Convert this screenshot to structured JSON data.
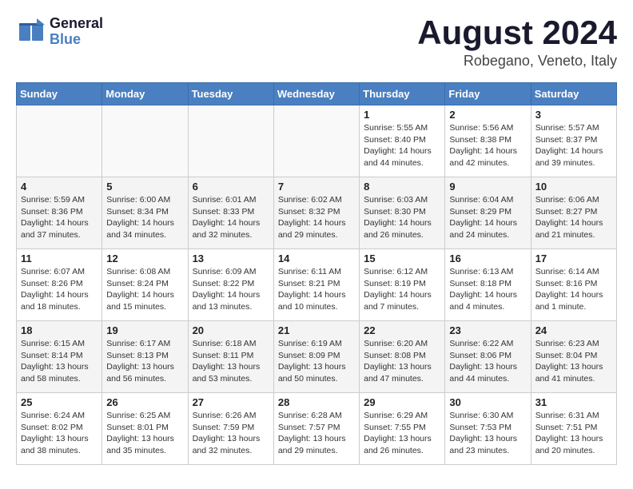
{
  "header": {
    "logo_line1": "General",
    "logo_line2": "Blue",
    "month_year": "August 2024",
    "location": "Robegano, Veneto, Italy"
  },
  "days_of_week": [
    "Sunday",
    "Monday",
    "Tuesday",
    "Wednesday",
    "Thursday",
    "Friday",
    "Saturday"
  ],
  "weeks": [
    [
      {
        "day": "",
        "content": ""
      },
      {
        "day": "",
        "content": ""
      },
      {
        "day": "",
        "content": ""
      },
      {
        "day": "",
        "content": ""
      },
      {
        "day": "1",
        "content": "Sunrise: 5:55 AM\nSunset: 8:40 PM\nDaylight: 14 hours\nand 44 minutes."
      },
      {
        "day": "2",
        "content": "Sunrise: 5:56 AM\nSunset: 8:38 PM\nDaylight: 14 hours\nand 42 minutes."
      },
      {
        "day": "3",
        "content": "Sunrise: 5:57 AM\nSunset: 8:37 PM\nDaylight: 14 hours\nand 39 minutes."
      }
    ],
    [
      {
        "day": "4",
        "content": "Sunrise: 5:59 AM\nSunset: 8:36 PM\nDaylight: 14 hours\nand 37 minutes."
      },
      {
        "day": "5",
        "content": "Sunrise: 6:00 AM\nSunset: 8:34 PM\nDaylight: 14 hours\nand 34 minutes."
      },
      {
        "day": "6",
        "content": "Sunrise: 6:01 AM\nSunset: 8:33 PM\nDaylight: 14 hours\nand 32 minutes."
      },
      {
        "day": "7",
        "content": "Sunrise: 6:02 AM\nSunset: 8:32 PM\nDaylight: 14 hours\nand 29 minutes."
      },
      {
        "day": "8",
        "content": "Sunrise: 6:03 AM\nSunset: 8:30 PM\nDaylight: 14 hours\nand 26 minutes."
      },
      {
        "day": "9",
        "content": "Sunrise: 6:04 AM\nSunset: 8:29 PM\nDaylight: 14 hours\nand 24 minutes."
      },
      {
        "day": "10",
        "content": "Sunrise: 6:06 AM\nSunset: 8:27 PM\nDaylight: 14 hours\nand 21 minutes."
      }
    ],
    [
      {
        "day": "11",
        "content": "Sunrise: 6:07 AM\nSunset: 8:26 PM\nDaylight: 14 hours\nand 18 minutes."
      },
      {
        "day": "12",
        "content": "Sunrise: 6:08 AM\nSunset: 8:24 PM\nDaylight: 14 hours\nand 15 minutes."
      },
      {
        "day": "13",
        "content": "Sunrise: 6:09 AM\nSunset: 8:22 PM\nDaylight: 14 hours\nand 13 minutes."
      },
      {
        "day": "14",
        "content": "Sunrise: 6:11 AM\nSunset: 8:21 PM\nDaylight: 14 hours\nand 10 minutes."
      },
      {
        "day": "15",
        "content": "Sunrise: 6:12 AM\nSunset: 8:19 PM\nDaylight: 14 hours\nand 7 minutes."
      },
      {
        "day": "16",
        "content": "Sunrise: 6:13 AM\nSunset: 8:18 PM\nDaylight: 14 hours\nand 4 minutes."
      },
      {
        "day": "17",
        "content": "Sunrise: 6:14 AM\nSunset: 8:16 PM\nDaylight: 14 hours\nand 1 minute."
      }
    ],
    [
      {
        "day": "18",
        "content": "Sunrise: 6:15 AM\nSunset: 8:14 PM\nDaylight: 13 hours\nand 58 minutes."
      },
      {
        "day": "19",
        "content": "Sunrise: 6:17 AM\nSunset: 8:13 PM\nDaylight: 13 hours\nand 56 minutes."
      },
      {
        "day": "20",
        "content": "Sunrise: 6:18 AM\nSunset: 8:11 PM\nDaylight: 13 hours\nand 53 minutes."
      },
      {
        "day": "21",
        "content": "Sunrise: 6:19 AM\nSunset: 8:09 PM\nDaylight: 13 hours\nand 50 minutes."
      },
      {
        "day": "22",
        "content": "Sunrise: 6:20 AM\nSunset: 8:08 PM\nDaylight: 13 hours\nand 47 minutes."
      },
      {
        "day": "23",
        "content": "Sunrise: 6:22 AM\nSunset: 8:06 PM\nDaylight: 13 hours\nand 44 minutes."
      },
      {
        "day": "24",
        "content": "Sunrise: 6:23 AM\nSunset: 8:04 PM\nDaylight: 13 hours\nand 41 minutes."
      }
    ],
    [
      {
        "day": "25",
        "content": "Sunrise: 6:24 AM\nSunset: 8:02 PM\nDaylight: 13 hours\nand 38 minutes."
      },
      {
        "day": "26",
        "content": "Sunrise: 6:25 AM\nSunset: 8:01 PM\nDaylight: 13 hours\nand 35 minutes."
      },
      {
        "day": "27",
        "content": "Sunrise: 6:26 AM\nSunset: 7:59 PM\nDaylight: 13 hours\nand 32 minutes."
      },
      {
        "day": "28",
        "content": "Sunrise: 6:28 AM\nSunset: 7:57 PM\nDaylight: 13 hours\nand 29 minutes."
      },
      {
        "day": "29",
        "content": "Sunrise: 6:29 AM\nSunset: 7:55 PM\nDaylight: 13 hours\nand 26 minutes."
      },
      {
        "day": "30",
        "content": "Sunrise: 6:30 AM\nSunset: 7:53 PM\nDaylight: 13 hours\nand 23 minutes."
      },
      {
        "day": "31",
        "content": "Sunrise: 6:31 AM\nSunset: 7:51 PM\nDaylight: 13 hours\nand 20 minutes."
      }
    ]
  ]
}
